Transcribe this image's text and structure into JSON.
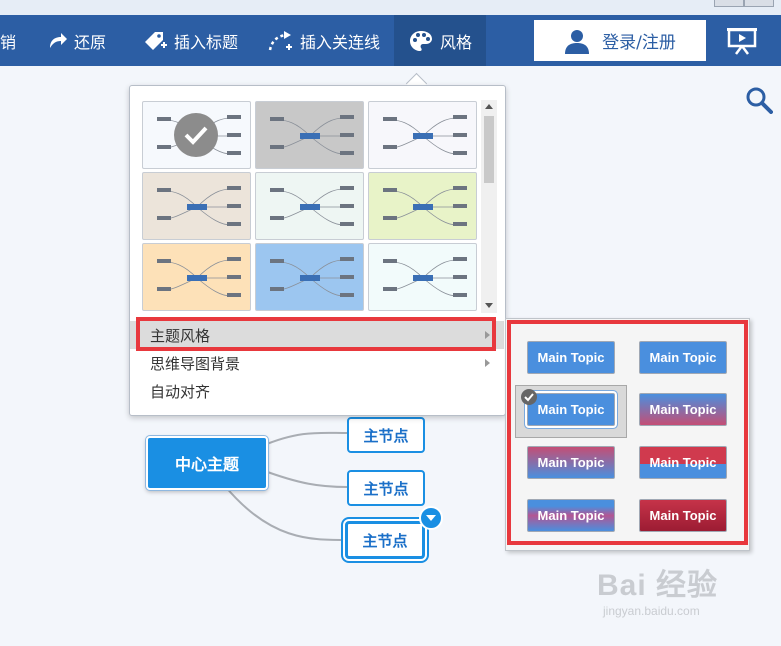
{
  "toolbar": {
    "undo_label": "销",
    "redo_label": "还原",
    "insert_title_label": "插入标题",
    "insert_link_label": "插入关连线",
    "style_label": "风格",
    "login_label": "登录/注册"
  },
  "menu": {
    "items": [
      {
        "label": "主题风格",
        "has_submenu": true
      },
      {
        "label": "思维导图背景",
        "has_submenu": true
      },
      {
        "label": "自动对齐",
        "has_submenu": false
      }
    ]
  },
  "themes": [
    {
      "bg": "#f6f9fd",
      "selected": true
    },
    {
      "bg": "#c8c8c8",
      "selected": false
    },
    {
      "bg": "#f7f7fb",
      "selected": false
    },
    {
      "bg": "#ece4da",
      "selected": false
    },
    {
      "bg": "#eef6f3",
      "selected": false
    },
    {
      "bg": "#e8f3c8",
      "selected": false
    },
    {
      "bg": "#fde1b8",
      "selected": false
    },
    {
      "bg": "#9cc6f0",
      "selected": false
    },
    {
      "bg": "#f2fbfb",
      "selected": false
    }
  ],
  "style_options": [
    {
      "label": "Main Topic",
      "style": "blue",
      "selected": false
    },
    {
      "label": "Main Topic",
      "style": "blue",
      "selected": false
    },
    {
      "label": "Main Topic",
      "style": "blue-outline",
      "selected": true
    },
    {
      "label": "Main Topic",
      "style": "blue-purple",
      "selected": false
    },
    {
      "label": "Main Topic",
      "style": "purple-blue",
      "selected": false
    },
    {
      "label": "Main Topic",
      "style": "red-blue",
      "selected": false
    },
    {
      "label": "Main Topic",
      "style": "blue-purple-2",
      "selected": false
    },
    {
      "label": "Main Topic",
      "style": "dark-red",
      "selected": false
    }
  ],
  "canvas": {
    "center_label": "中心主题",
    "nodes": [
      "主节点",
      "主节点",
      "主节点"
    ]
  },
  "watermark": {
    "brand": "Bai 经验",
    "url": "jingyan.baidu.com"
  },
  "colors": {
    "toolbar": "#2c5ea4",
    "accent": "#1a8fe3",
    "highlight": "#e8383d"
  }
}
